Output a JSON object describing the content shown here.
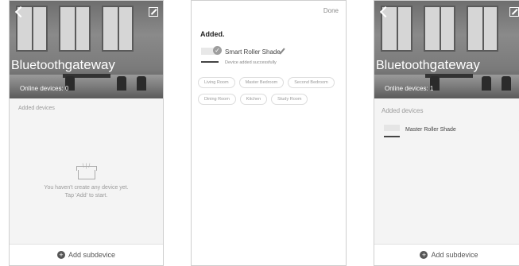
{
  "screen1": {
    "title_part1": "Bluetooth",
    "title_part2": "gateway",
    "online_devices": "Online devices: 0",
    "section_label": "Added devices",
    "empty_line1": "You haven't create any device yet.",
    "empty_line2": "Tap 'Add' to start.",
    "footer_label": "Add subdevice"
  },
  "screen2": {
    "done_label": "Done",
    "added_title": "Added.",
    "device_name": "Smart Roller Shade",
    "added_message": "Device added successfully",
    "rooms": [
      "Living Room",
      "Master Bedroom",
      "Second Bedroom",
      "Dining Room",
      "Kitchen",
      "Study Room"
    ]
  },
  "screen3": {
    "title_part1": "Bluetooth",
    "title_part2": "gateway",
    "online_devices": "Online devices: 1",
    "section_label": "Added devices",
    "device_name": "Master Roller Shade",
    "footer_label": "Add subdevice"
  },
  "icons": {
    "back": "back-arrow-icon",
    "edit": "edit-icon",
    "empty": "empty-box-icon",
    "add": "plus-circle-icon",
    "check": "check-icon",
    "rename": "pencil-icon",
    "more": "more-dots-icon"
  },
  "colors": {
    "hero_overlay_text": "#ffffff",
    "muted_text": "#9a9a9a",
    "chip_border": "#dcdcdc"
  }
}
